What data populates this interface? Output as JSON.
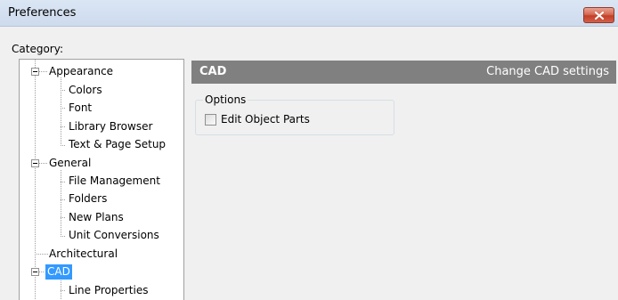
{
  "window": {
    "title": "Preferences",
    "close_icon": "close-x-icon"
  },
  "category_label": "Category:",
  "tree": {
    "appearance": {
      "label": "Appearance",
      "children": [
        "Colors",
        "Font",
        "Library Browser",
        "Text & Page Setup"
      ]
    },
    "general": {
      "label": "General",
      "children": [
        "File Management",
        "Folders",
        "New Plans",
        "Unit Conversions"
      ]
    },
    "architectural": "Architectural",
    "cad": {
      "label": "CAD",
      "selected": true,
      "children": [
        "Line Properties"
      ]
    }
  },
  "panel": {
    "title": "CAD",
    "subtitle": "Change CAD settings",
    "options_group": "Options",
    "edit_object_parts": {
      "label": "Edit Object Parts",
      "checked": false
    }
  },
  "colors": {
    "selection": "#3399ff",
    "header_bg": "#808080",
    "close_button": "#c94a33"
  }
}
